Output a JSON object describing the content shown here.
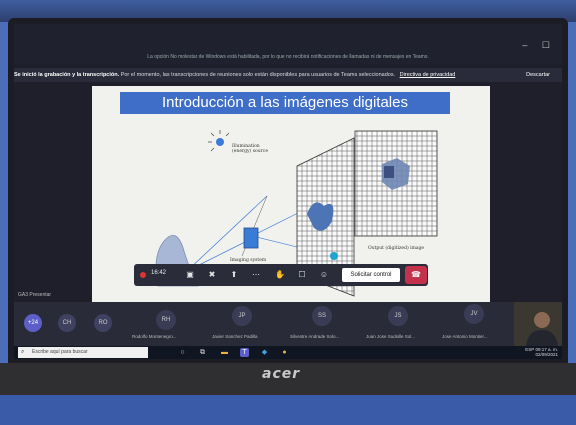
{
  "window": {
    "notice": "La opción No molestar de Windows está habilitada, por lo que no recibirá notificaciones de llamadas ni de mensajes en Teams.",
    "controls": "–  ☐"
  },
  "banner": {
    "bold": "Se inició la grabación y la transcripción.",
    "text": "Por el momento, las transcripciones de reuniones solo están disponibles para usuarios de Teams seleccionados.",
    "link": "Directiva de privacidad",
    "dismiss": "Descartar"
  },
  "slide": {
    "title": "Introducción a las imágenes digitales",
    "illum_label": "Illumination (energy) source",
    "imaging_label": "Imaging system",
    "output_label": "Output (digitized) image"
  },
  "controls": {
    "timer": "16:42",
    "request_control": "Solicitar control"
  },
  "presenter_label": "GA3 Presentar",
  "participants": {
    "overflow": "+24",
    "small": [
      "CH",
      "RO"
    ],
    "big": [
      {
        "initials": "RH",
        "name": "Rodolfo Montenegro..."
      },
      {
        "initials": "JP",
        "name": "Javier Sanchez Padilla"
      },
      {
        "initials": "SS",
        "name": "Silvestre Andrade Solo..."
      },
      {
        "initials": "JS",
        "name": "Juan Jose Sudsille Sol..."
      },
      {
        "initials": "JV",
        "name": "Jose Antonio Montier..."
      }
    ]
  },
  "taskbar": {
    "search_placeholder": "Escribe aquí para buscar",
    "time": "09:17 a. m.",
    "date": "02/09/2021",
    "lang": "ESP"
  },
  "laptop": {
    "brand": "acer"
  }
}
